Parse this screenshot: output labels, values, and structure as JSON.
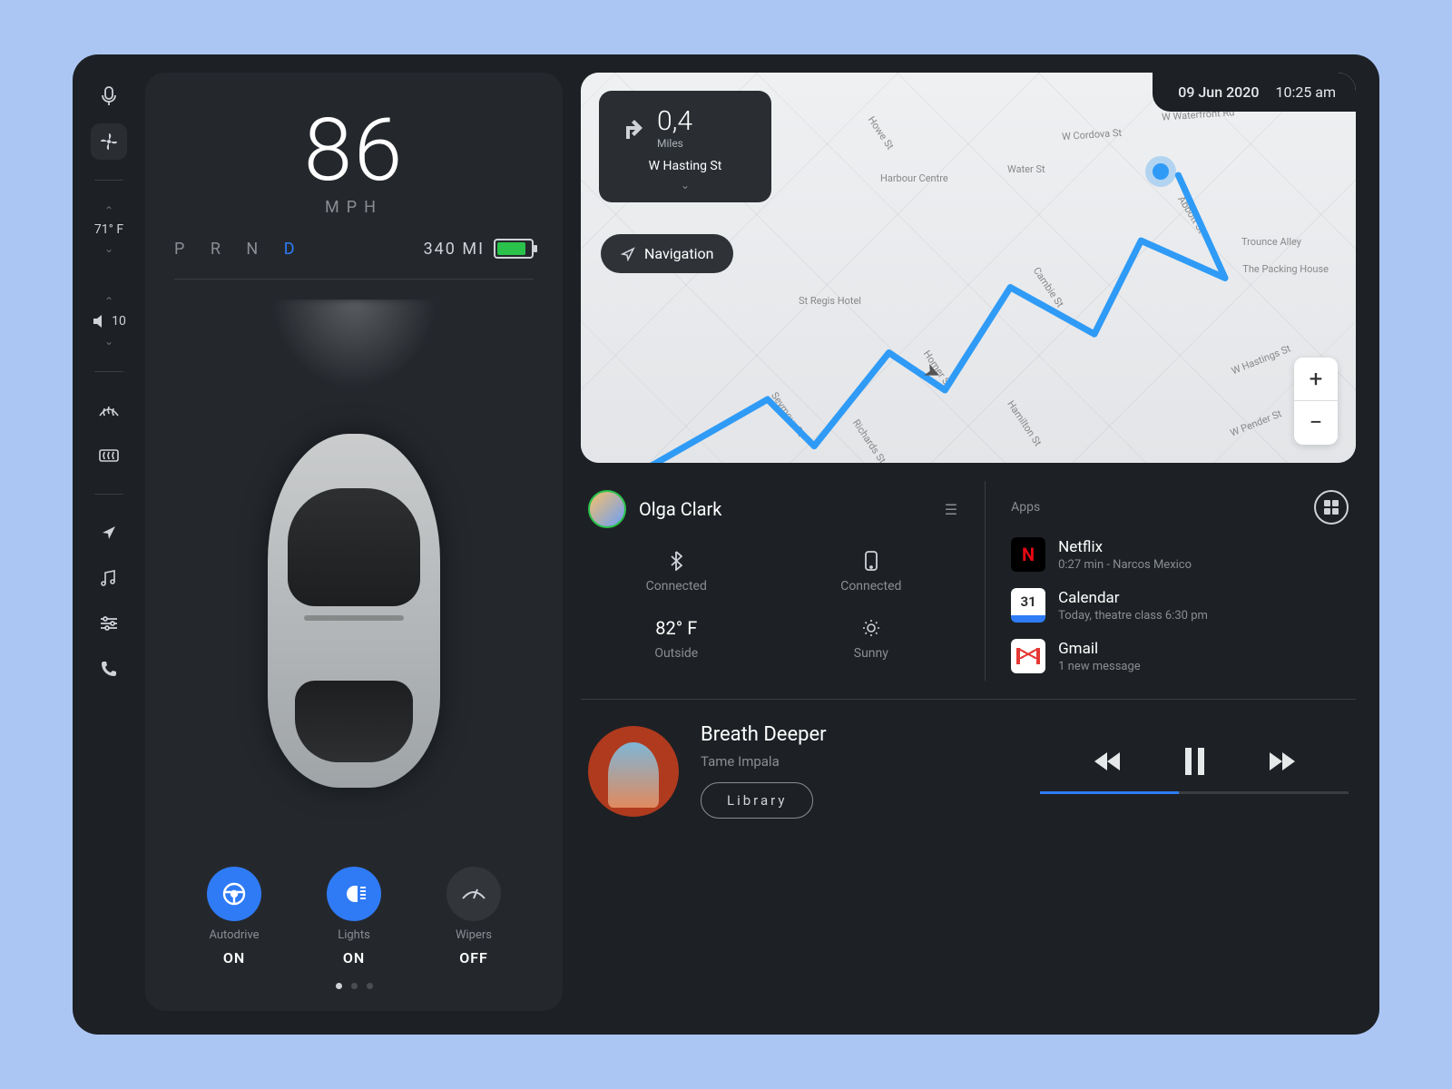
{
  "datetime": {
    "date": "09 Jun 2020",
    "time": "10:25 am"
  },
  "sidebar": {
    "temp": "71° F",
    "volume": "10"
  },
  "driving": {
    "speed": "86",
    "speed_unit": "MPH",
    "gears": {
      "p": "P",
      "r": "R",
      "n": "N",
      "d": "D",
      "active": "D"
    },
    "range": "340 MI",
    "toggles": {
      "autodrive": {
        "label": "Autodrive",
        "state": "ON"
      },
      "lights": {
        "label": "Lights",
        "state": "ON"
      },
      "wipers": {
        "label": "Wipers",
        "state": "OFF"
      }
    }
  },
  "nav": {
    "distance": "0,4",
    "distance_unit": "Miles",
    "street": "W Hasting St",
    "pill_label": "Navigation",
    "map_labels": {
      "a": "Harbour Centre",
      "b": "Water St",
      "c": "W Cordova St",
      "d": "W Waterfront Rd",
      "e": "Abbott St",
      "f": "Trounce Alley",
      "g": "The Packing House",
      "h": "St Regis Hotel",
      "i": "Homer St",
      "j": "Cambie St",
      "k": "W Hastings St",
      "l": "W Pender St",
      "m": "Seymour St",
      "n": "Richards St",
      "o": "Howe St",
      "p": "Hamilton St"
    }
  },
  "user": {
    "name": "Olga Clark",
    "bluetooth": "Connected",
    "phone": "Connected",
    "outside_temp": "82° F",
    "outside_label": "Outside",
    "weather": "Sunny"
  },
  "apps": {
    "title": "Apps",
    "items": [
      {
        "name": "Netflix",
        "sub": "0:27 min - Narcos Mexico"
      },
      {
        "name": "Calendar",
        "sub": "Today, theatre class 6:30 pm",
        "day": "31"
      },
      {
        "name": "Gmail",
        "sub": "1 new message"
      }
    ]
  },
  "player": {
    "title": "Breath Deeper",
    "artist": "Tame Impala",
    "library_label": "Library"
  }
}
